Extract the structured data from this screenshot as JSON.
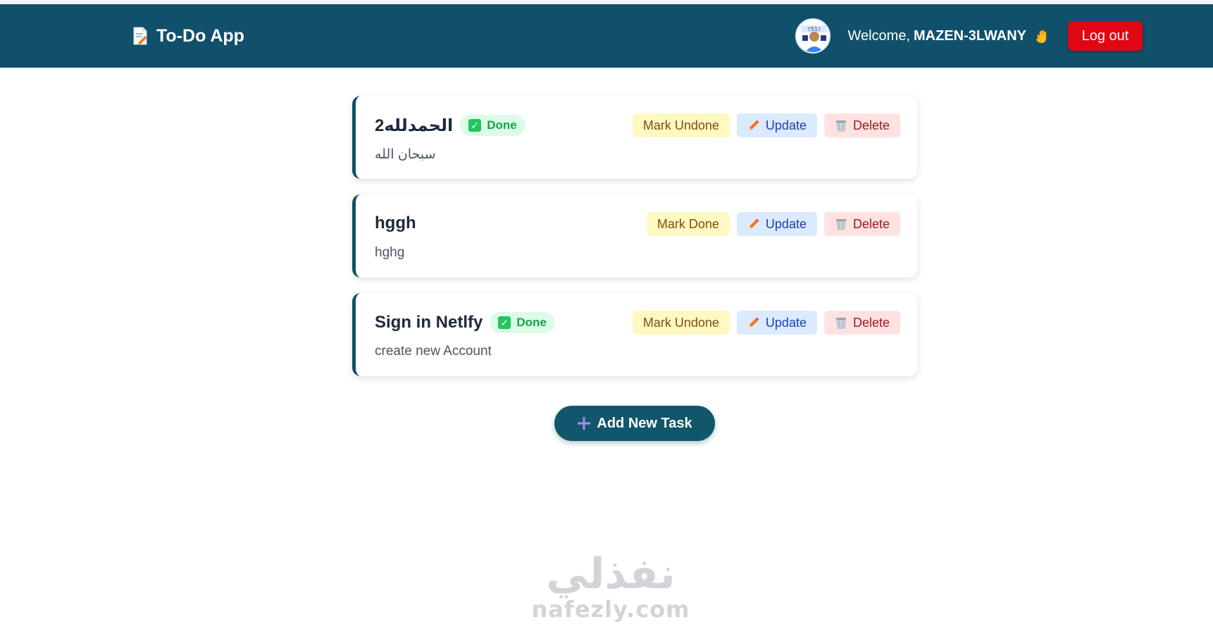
{
  "header": {
    "app_title": "To-Do App",
    "app_icon": "memo-icon",
    "welcome_prefix": "Welcome,",
    "username": "MAZEN-3LWANY",
    "wave_icon": "waving-hand-icon",
    "logout_label": "Log out"
  },
  "tasks": [
    {
      "title": "الحمدلله2",
      "status_label": "Done",
      "description": "سبحان الله",
      "toggle_label": "Mark Undone",
      "update_label": "Update",
      "delete_label": "Delete"
    },
    {
      "title": "hggh",
      "status_label": "",
      "description": "hghg",
      "toggle_label": "Mark Done",
      "update_label": "Update",
      "delete_label": "Delete"
    },
    {
      "title": "Sign in Netlfy",
      "status_label": "Done",
      "description": "create new Account",
      "toggle_label": "Mark Undone",
      "update_label": "Update",
      "delete_label": "Delete"
    }
  ],
  "add_task_label": "Add New Task",
  "watermark": {
    "arabic": "نفذلي",
    "latin": "nafezly.com"
  },
  "colors": {
    "header_bg": "#11506a",
    "logout_bg": "#e10613",
    "done_badge_bg": "#dcfce7",
    "done_badge_text": "#16a34a",
    "mark_bg": "#fef9c3",
    "update_bg": "#dbeafe",
    "delete_bg": "#fee2e2",
    "add_button_bg": "#11566b"
  }
}
